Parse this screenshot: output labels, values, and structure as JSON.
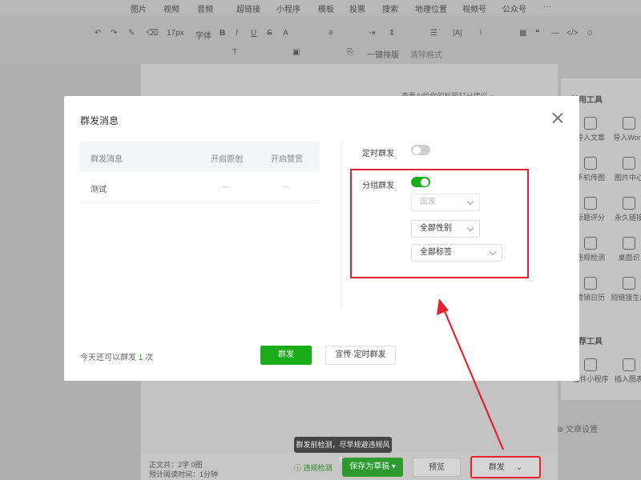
{
  "editor": {
    "top_menu": [
      "图片",
      "视频",
      "音频",
      "超链接",
      "小程序",
      "模板",
      "投票",
      "搜索",
      "地理位置",
      "视频号",
      "公众号",
      "···"
    ],
    "toolbar": {
      "font_size": "17px",
      "font_family": "字体",
      "one_click_layout": "一键排版",
      "clear_format": "清除格式"
    },
    "ai_hint": "查看AI给你的标题打分建议 ~"
  },
  "right_panel": {
    "section1_title": "常用工具",
    "section1_items": [
      "导入文章",
      "导入Word",
      "手机传图",
      "图片中心",
      "标题评分",
      "永久链接",
      "违规检测",
      "桌面识",
      "营销日历",
      "短链接生成"
    ],
    "section2_title": "推荐工具",
    "section2_items": [
      "插件小程序",
      "插入图表"
    ],
    "article_settings": "文章设置"
  },
  "bottom_bar": {
    "word_count": "正文共：2字 0图",
    "read_time": "预计阅读时间：1分钟",
    "tooltip": "群发前检测，尽早规避违规风险",
    "violation_check": "违规检测",
    "save_draft": "保存为草稿",
    "preview": "预览",
    "publish": "群发"
  },
  "modal": {
    "title": "群发消息",
    "table": {
      "headers": [
        "群发消息",
        "开启原创",
        "开启赞赏"
      ],
      "rows": [
        [
          "测试",
          "—",
          "—"
        ]
      ]
    },
    "options": {
      "scheduled_label": "定时群发",
      "scheduled_on": false,
      "group_label": "分组群发",
      "group_on": true,
      "country_placeholder": "国家",
      "gender_value": "全部性别",
      "tag_value": "全部标签"
    },
    "footer": {
      "remaining_prefix": "今天还可以群发",
      "remaining_count": "1",
      "remaining_suffix": "次",
      "publish_button": "群发",
      "publish_later_button": "宣传·定时群发"
    }
  },
  "colors": {
    "primary_green": "#1aad19",
    "annotation_red": "#e3222f"
  }
}
